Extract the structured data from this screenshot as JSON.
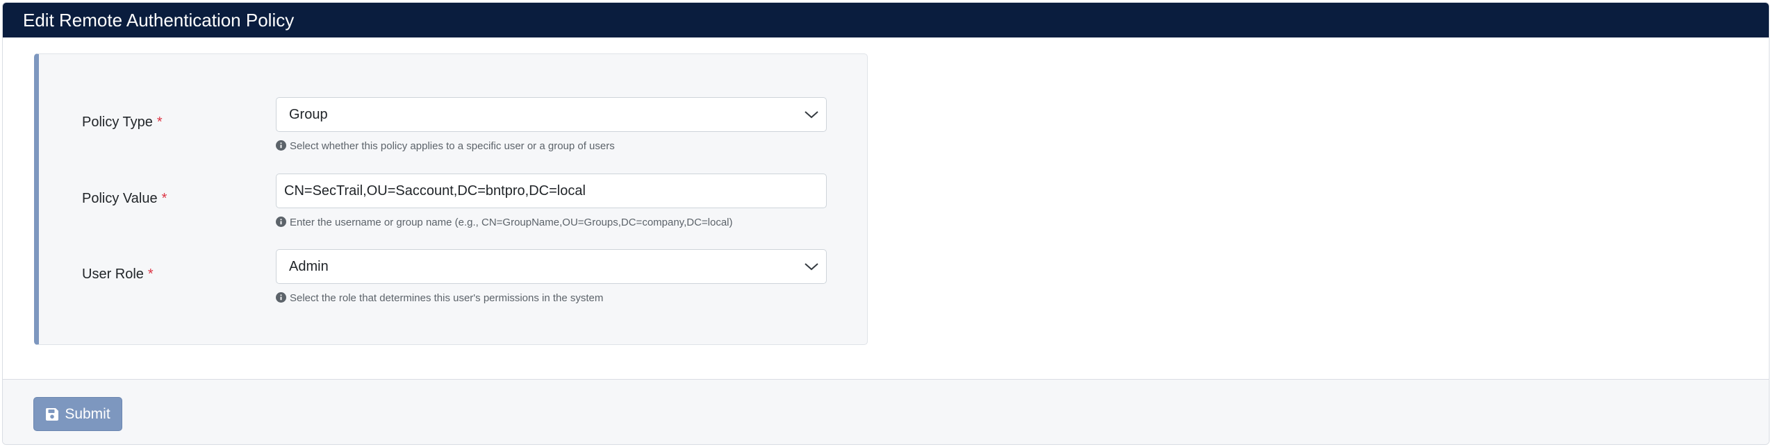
{
  "header": {
    "title": "Edit Remote Authentication Policy"
  },
  "form": {
    "required_marker": "*",
    "policy_type": {
      "label": "Policy Type",
      "value": "Group",
      "help": "Select whether this policy applies to a specific user or a group of users"
    },
    "policy_value": {
      "label": "Policy Value",
      "value": "CN=SecTrail,OU=Saccount,DC=bntpro,DC=local",
      "help": "Enter the username or group name (e.g., CN=GroupName,OU=Groups,DC=company,DC=local)"
    },
    "user_role": {
      "label": "User Role",
      "value": "Admin",
      "help": "Select the role that determines this user's permissions in the system"
    }
  },
  "footer": {
    "submit_label": "Submit"
  },
  "icons": {
    "info": "info-circle-icon",
    "chevron": "chevron-down-icon",
    "save": "floppy-disk-icon"
  },
  "colors": {
    "header_bg": "#0a1d3e",
    "panel_accent": "#7d97bf",
    "required": "#dc3545",
    "submit_bg": "#7d97bf"
  }
}
